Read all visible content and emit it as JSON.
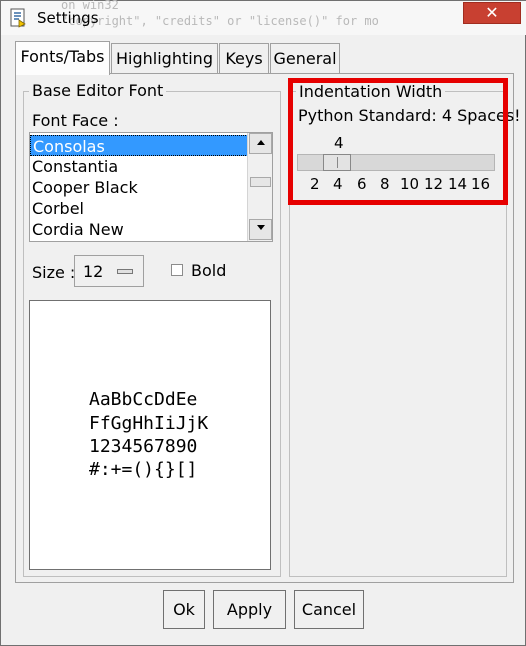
{
  "window": {
    "title": "Settings",
    "background_text_1": "on win32",
    "background_text_2": "\"copyright\", \"credits\" or \"license()\" for mo",
    "close_glyph": "✕"
  },
  "tabs": [
    {
      "label": "Fonts/Tabs",
      "active": true
    },
    {
      "label": "Highlighting"
    },
    {
      "label": "Keys"
    },
    {
      "label": "General"
    }
  ],
  "base_font": {
    "legend": "Base Editor Font",
    "font_face_label": "Font Face :",
    "fonts": [
      "Consolas",
      "Constantia",
      "Cooper Black",
      "Corbel",
      "Cordia New"
    ],
    "selected_font": "Consolas",
    "size_label": "Size :",
    "size_value": "12",
    "bold_label": "Bold",
    "bold_checked": false,
    "preview_lines": [
      "AaBbCcDdEe",
      "FfGgHhIiJjK",
      "1234567890",
      "#:+=(){}[]"
    ]
  },
  "indentation": {
    "legend": "Indentation Width",
    "note": "Python Standard: 4 Spaces!",
    "value": "4",
    "ticks": [
      "2",
      "4",
      "6",
      "8",
      "10",
      "12",
      "14",
      "16"
    ]
  },
  "buttons": {
    "ok": "Ok",
    "apply": "Apply",
    "cancel": "Cancel"
  },
  "colors": {
    "selection": "#3399ff",
    "highlight": "#e60000",
    "close": "#c84031"
  }
}
